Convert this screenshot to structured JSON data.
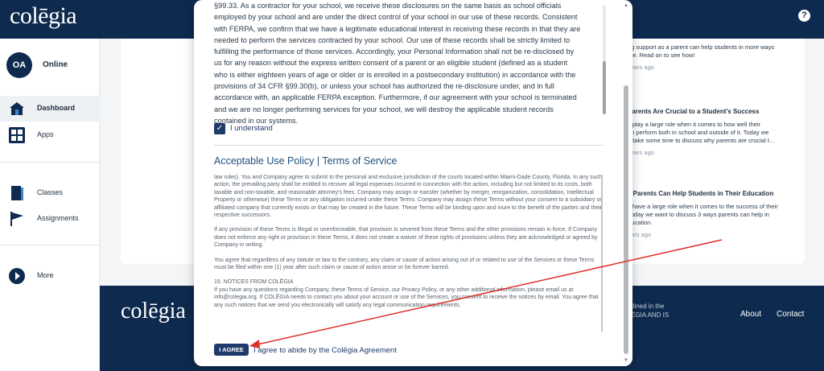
{
  "header": {
    "logo": "colēgia",
    "help_icon": "?"
  },
  "sidebar": {
    "avatar_initials": "OA",
    "status": "Online",
    "items": [
      {
        "label": "Dashboard",
        "icon": "home-icon"
      },
      {
        "label": "Apps",
        "icon": "apps-grid-icon"
      },
      {
        "label": "Classes",
        "icon": "book-icon"
      },
      {
        "label": "Assignments",
        "icon": "flag-icon"
      },
      {
        "label": "More",
        "icon": "play-circle-icon"
      }
    ]
  },
  "news": [
    {
      "title": "",
      "lines": [
        "ng support as a parent can help students in more ways",
        "me. Read on to see how!"
      ],
      "ago": "years ago"
    },
    {
      "title": "Parents Are Crucial to a Student's Success",
      "lines": [
        "s play a large role when it comes to how well their",
        "en perform both in school and outside of it. Today we",
        "o take some time to discuss why parents are crucial t…"
      ],
      "ago": "years ago"
    },
    {
      "title": "s Parents Can Help Students in Their Education",
      "lines": [
        "s have a large role when it comes to the success of their",
        "Today we want to discuss 3 ways parents can help in",
        "ducation."
      ],
      "ago": "ears ago"
    }
  ],
  "footer": {
    "logo": "colēgia",
    "text_line1": "dined in the",
    "text_line2": "ĒGIA AND IS",
    "links": [
      "About",
      "Contact"
    ]
  },
  "modal": {
    "ferpa_lines": [
      "§99.33. As a contractor for your school, we receive these disclosures on the same basis as school officials",
      "employed by your school and are under the direct control of your school in our use of these records. Consistent",
      "with FERPA, we confirm that we have a legitimate educational interest in receiving these records in that they are",
      "needed to perform the services contracted by your school. Our use of these records shall be strictly limited to",
      "fulfilling the performance of those services. Accordingly, your Personal Information shall not be re-disclosed by",
      "us for any reason without the express written consent of a parent or an eligible student (defined as a student",
      "who is either eighteen years of age or older or is enrolled in a postsecondary institution) in accordance with the",
      "provisions of 34 CFR §99.30(b), or unless your school has authorized the re-disclosure under, and in full",
      "accordance with, an applicable FERPA exception. Furthermore, if our agreement with your school is terminated",
      "and we are no longer performing services for your school, we will destroy the applicable student records",
      "contained in our systems."
    ],
    "checkbox_label": "I understand",
    "checkbox_checked": true,
    "aup_title": "Acceptable Use Policy | Terms of Service",
    "aup_paragraphs": [
      "law rules). You and Company agree to submit to the personal and exclusive jurisdiction of the courts located within Miami-Dade County, Florida. In any such action, the prevailing party shall be entitled to recover all legal expenses incurred in connection with the action, including but not limited to its costs, both taxable and non-taxable, and reasonable attorney's fees. Company may assign or transfer (whether by merger, reorganization, consolidation, Intellectual Property or otherwise) these Terms or any obligation incurred under these Terms. Company may assign these Terms without your consent to a subsidiary or affiliated company that currently exists or that may be created in the future. These Terms will be binding upon and inure to the benefit of the parties and their respective successors.",
      "If any provision of these Terms is illegal or unenforceable, that provision is severed from these Terms and the other provisions remain in force. If Company does not enforce any right or provision in these Terms, it does not create a waiver of these rights of provisions unless they are acknowledged or agreed by Company in writing.",
      "You agree that regardless of any statute or law to the contrary, any claim or cause of action arising out of or related to use of the Services or these Terms must be filed within one (1) year after such claim or cause of action arose or be forever barred.",
      "15. NOTICES FROM COLĒGIA\nIf you have any questions regarding Company, these Terms of Service, our Privacy Policy, or any other additional information, please email us at info@colegia.org. If COLĒGIA needs to contact you about your account or use of the Services, you consent to receive the notices by email. You agree that any such notices that we send you electronically will satisfy any legal communication requirements."
    ],
    "agree_button": "I AGREE",
    "agree_text": "I agree to abide by the Colēgia Agreement"
  },
  "colors": {
    "navy": "#0e2a4e",
    "button": "#1e3a6b",
    "link_blue": "#1e4f7d",
    "annotation_arrow": "#e0302a"
  }
}
